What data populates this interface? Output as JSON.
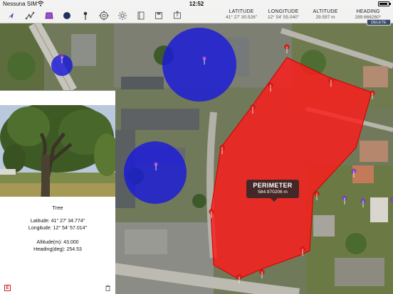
{
  "status_bar": {
    "carrier": "Nessuna SIM",
    "time": "12:52"
  },
  "toolbar": {
    "icons": [
      "cursor-arrow-icon",
      "polyline-icon",
      "polygon-icon",
      "circle-icon",
      "pin-icon",
      "target-icon",
      "settings-icon",
      "notebook-icon",
      "save-icon",
      "export-icon"
    ],
    "readouts": [
      {
        "label": "LATITUDE",
        "value": "41° 27' 30.526\""
      },
      {
        "label": "LONGITUDE",
        "value": "12° 54' 55.040\""
      },
      {
        "label": "ALTITUDE",
        "value": "29.597 m"
      },
      {
        "label": "HEADING",
        "value": "289.666260°"
      }
    ],
    "delete_label": "DELETE",
    "accent": "#5a3ab8"
  },
  "map": {
    "tooltip_title": "PERIMETER",
    "tooltip_value": "584.970206 m",
    "polygon_color": "#ff1a1a",
    "circle_color": "#1a1adb"
  },
  "panel": {
    "title": "Tree",
    "latitude": "Latitude: 41° 27' 34.774\"",
    "longitude": "Longitude: 12° 54' 57.014\"",
    "altitude": "Altitude(m): 43.000",
    "heading": "Heading(deg): 254.53",
    "edit_label": "E"
  }
}
